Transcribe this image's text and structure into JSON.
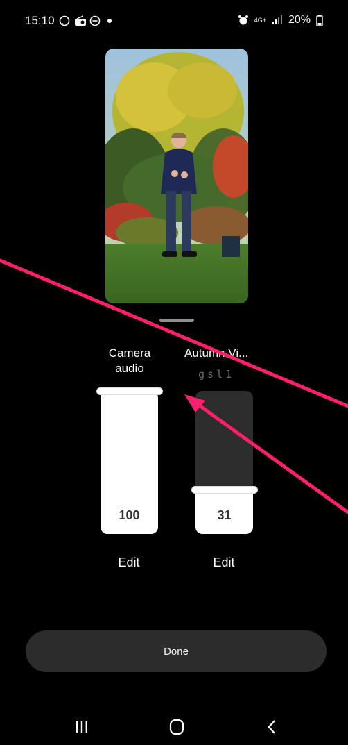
{
  "status_bar": {
    "time": "15:10",
    "network": "4G+",
    "battery": "20%"
  },
  "tracks": [
    {
      "name_line1": "Camera",
      "name_line2": "audio",
      "level": 100,
      "value_label": "100",
      "edit_label": "Edit"
    },
    {
      "name_line1": "Autumn Vi...",
      "name_line2": "",
      "subtitle": "gsl1",
      "level": 31,
      "value_label": "31",
      "edit_label": "Edit"
    }
  ],
  "done_label": "Done",
  "colors": {
    "background": "#000000",
    "annotation_arrow": "#ff1f6d",
    "slider_track": "#2d2d2d",
    "slider_fill": "#ffffff",
    "button_bg": "#2c2c2c"
  },
  "icons": {
    "status_left": [
      "whatsapp-icon",
      "radio-icon",
      "minus-circle-icon"
    ],
    "status_right": [
      "alarm-icon",
      "network-4g-icon",
      "signal-icon",
      "battery-icon"
    ],
    "nav": [
      "recent-apps-icon",
      "home-icon",
      "back-icon"
    ]
  }
}
